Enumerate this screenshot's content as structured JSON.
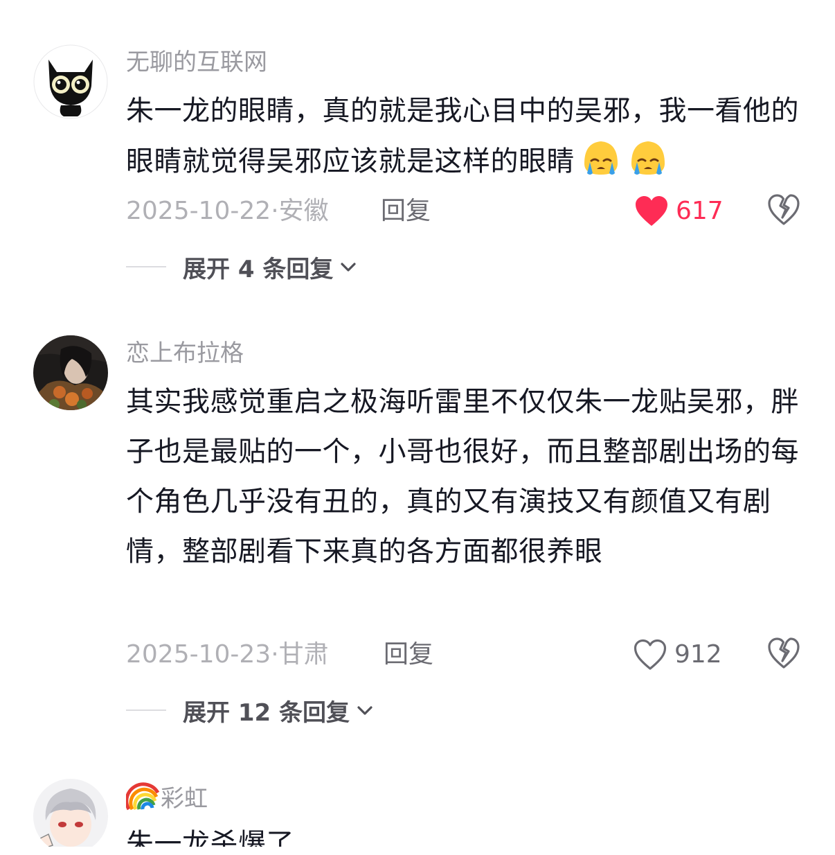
{
  "comments": [
    {
      "username": "无聊的互联网",
      "text": "朱一龙的眼睛，真的就是我心目中的吴邪，我一看他的眼睛就觉得吴邪应该就是这样的眼睛",
      "emojis": [
        "crying-face-emoji",
        "crying-face-emoji"
      ],
      "date": "2025-10-22",
      "separator": "·",
      "location": "安徽",
      "reply_label": "回复",
      "likes": "617",
      "liked": true,
      "expand_label": "展开 4 条回复"
    },
    {
      "username": "恋上布拉格",
      "text": "其实我感觉重启之极海听雷里不仅仅朱一龙贴吴邪，胖子也是最贴的一个，小哥也很好，而且整部剧出场的每个角色几乎没有丑的，真的又有演技又有颜值又有剧情，整部剧看下来真的各方面都很养眼",
      "date": "2025-10-23",
      "separator": "·",
      "location": "甘肃",
      "reply_label": "回复",
      "likes": "912",
      "liked": false,
      "expand_label": "展开 12 条回复"
    },
    {
      "username_emoji": "rainbow-emoji",
      "username": "彩虹",
      "text": "朱一龙杀爆了"
    }
  ],
  "colors": {
    "like_active": "#fe2c55",
    "username": "#9a9aa0",
    "text": "#161823"
  }
}
